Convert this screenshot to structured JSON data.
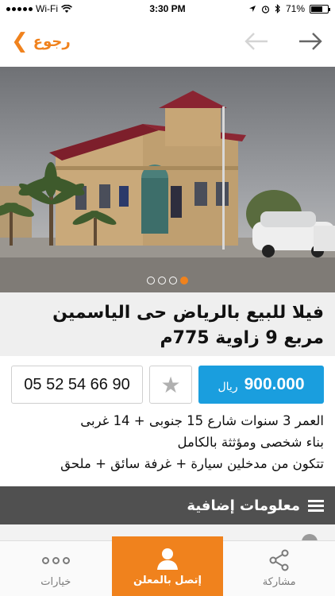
{
  "status_bar": {
    "carrier": "Wi-Fi",
    "time": "3:30 PM",
    "battery": "71%",
    "battery_level": 0.71
  },
  "nav": {
    "back_label": "رجوع"
  },
  "gallery": {
    "image_count": 4,
    "active_index": 3
  },
  "listing": {
    "title": "فيلا للبيع بالرياض حى الياسمين مربع 9 زاوية 775م",
    "phone": "05 52 54 66 90",
    "price": "900.000",
    "currency": "ريال",
    "description": [
      "العمر 3 سنوات شارع 15 جنوبى + 14 غربى",
      "بناء شخصى ومؤثثة بالكامل",
      "تتكون من مدخلين سيارة + غرفة سائق + ملحق"
    ]
  },
  "section": {
    "title": "معلومات إضافية"
  },
  "tabs": {
    "options": "خيارات",
    "contact": "إتصل بالمعلن",
    "share": "مشاركة"
  },
  "colors": {
    "accent": "#f0821d",
    "price_bg": "#1a9ede",
    "section_bg": "#505050"
  }
}
